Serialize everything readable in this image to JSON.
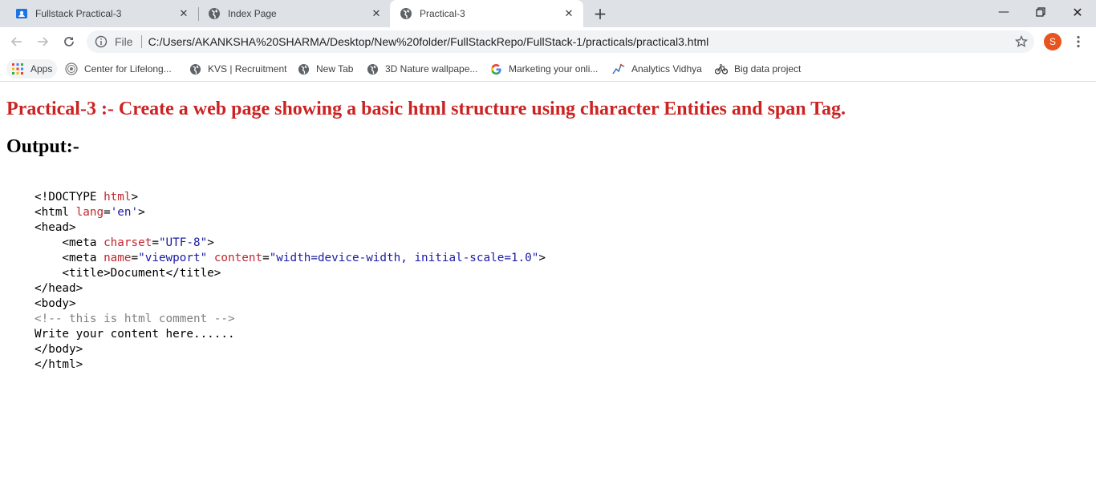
{
  "tabs": [
    {
      "title": "Fullstack Practical-3",
      "icon": "classroom-icon",
      "active": false
    },
    {
      "title": "Index Page",
      "icon": "globe-icon",
      "active": false
    },
    {
      "title": "Practical-3",
      "icon": "globe-icon",
      "active": true
    }
  ],
  "toolbar": {
    "scheme_label": "File",
    "url": "C:/Users/AKANKSHA%20SHARMA/Desktop/New%20folder/FullStackRepo/FullStack-1/practicals/practical3.html",
    "avatar_letter": "S"
  },
  "bookmarks": [
    {
      "label": "Apps",
      "icon": "apps-grid-icon"
    },
    {
      "label": "Center for Lifelong...",
      "icon": "seal-icon"
    },
    {
      "label": "KVS | Recruitment",
      "icon": "globe-icon"
    },
    {
      "label": "New Tab",
      "icon": "globe-icon"
    },
    {
      "label": "3D Nature wallpape...",
      "icon": "globe-icon"
    },
    {
      "label": "Marketing your onli...",
      "icon": "google-icon"
    },
    {
      "label": "Analytics Vidhya",
      "icon": "analytics-icon"
    },
    {
      "label": "Big data project",
      "icon": "bike-icon"
    }
  ],
  "page": {
    "heading": "Practical-3 :- Create a web page showing a basic html structure using character Entities and span Tag.",
    "output_label": "Output:-",
    "code": {
      "l1_a": "<!DOCTYPE ",
      "l1_b": "html",
      "l1_c": ">",
      "l2_a": "<html ",
      "l2_b": "lang",
      "l2_c": "=",
      "l2_d": "'en'",
      "l2_e": ">",
      "l3": "<head>",
      "l4_a": "    <meta ",
      "l4_b": "charset",
      "l4_c": "=",
      "l4_d": "\"UTF-8\"",
      "l4_e": ">",
      "l5_a": "    <meta ",
      "l5_b": "name",
      "l5_c": "=",
      "l5_d": "\"viewport\"",
      "l5_e": " ",
      "l5_f": "content",
      "l5_g": "=",
      "l5_h": "\"width=device-width, initial-scale=1.0\"",
      "l5_i": ">",
      "l6": "    <title>Document</title>",
      "l7": "</head>",
      "l8": "<body>",
      "l9": "<!-- this is html comment -->",
      "l10": "Write your content here......",
      "l11": "</body>",
      "l12": "</html>"
    }
  },
  "colors": {
    "heading": "#cc2222",
    "attr": "#c1272d",
    "value": "#1a1aa6",
    "comment": "#808080",
    "avatar": "#e8541f"
  }
}
